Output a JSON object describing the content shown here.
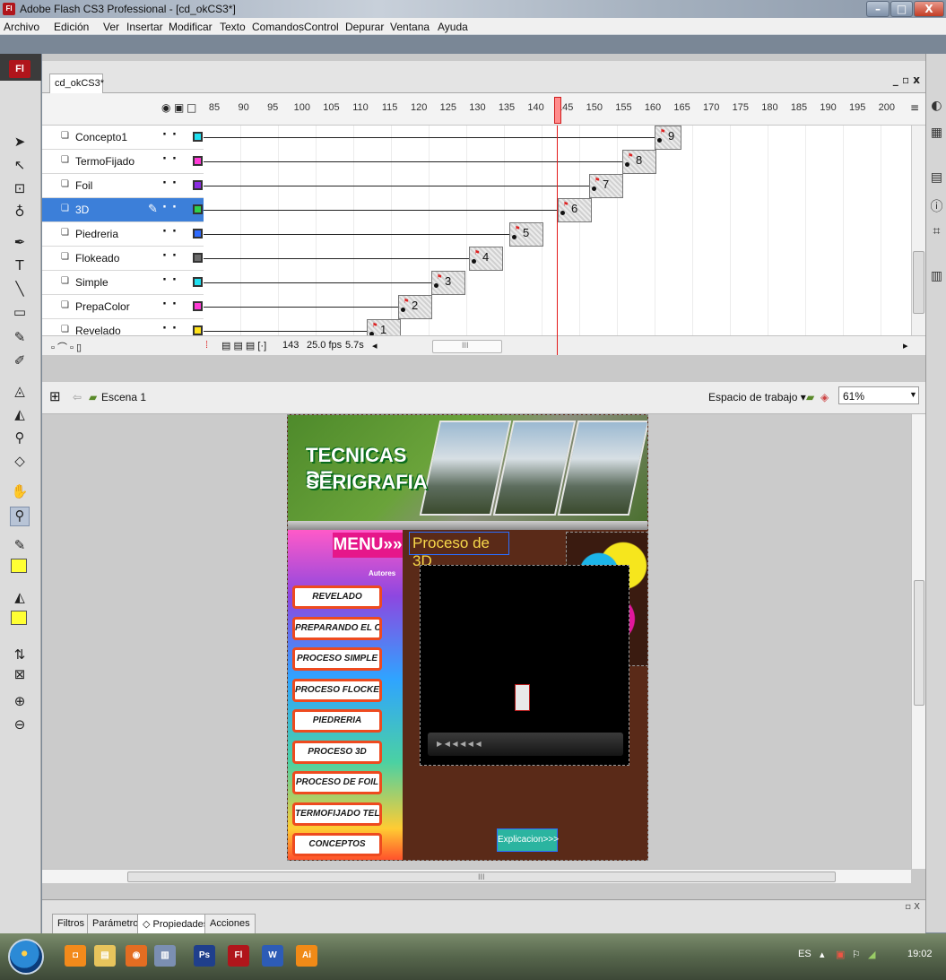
{
  "window": {
    "title": "Adobe Flash CS3 Professional - [cd_okCS3*]",
    "app_icon": "Fl",
    "minimize": "–",
    "maximize": "□",
    "close": "X"
  },
  "menubar": [
    "Archivo",
    "Edición",
    "Ver",
    "Insertar",
    "Modificar",
    "Texto",
    "Comandos",
    "Control",
    "Depurar",
    "Ventana",
    "Ayuda"
  ],
  "document": {
    "tab": "cd_okCS3*",
    "controls": "_ ▫ x"
  },
  "timeline": {
    "frame_numbers": [
      "85",
      "90",
      "95",
      "100",
      "105",
      "110",
      "115",
      "120",
      "125",
      "130",
      "135",
      "140",
      "145",
      "150",
      "155",
      "160",
      "165",
      "170",
      "175",
      "180",
      "185",
      "190",
      "195",
      "200"
    ],
    "layers": [
      {
        "name": "Concepto1",
        "color": "#20e0f0",
        "keyframe_label": "9"
      },
      {
        "name": "TermoFijado",
        "color": "#ff3ad6",
        "keyframe_label": "8"
      },
      {
        "name": "Foil",
        "color": "#8a2be2",
        "keyframe_label": "7"
      },
      {
        "name": "3D",
        "color": "#2ed04a",
        "keyframe_label": "6"
      },
      {
        "name": "Piedreria",
        "color": "#2f6bff",
        "keyframe_label": "5"
      },
      {
        "name": "Flokeado",
        "color": "#6b6b6b",
        "keyframe_label": "4"
      },
      {
        "name": "Simple",
        "color": "#20e0f0",
        "keyframe_label": "3"
      },
      {
        "name": "PrepaColor",
        "color": "#ff3ad6",
        "keyframe_label": "2"
      },
      {
        "name": "Revelado",
        "color": "#ffe21a",
        "keyframe_label": "1"
      }
    ],
    "active_layer": "3D",
    "current_frame": "143",
    "fps": "25.0 fps",
    "elapsed": "5.7s",
    "scroll_label": "III"
  },
  "editbar": {
    "scene": "Escena 1",
    "workspace": "Espacio de trabajo ▾",
    "zoom": "61%"
  },
  "stage": {
    "banner_title_line1": "TECNICAS DE",
    "banner_title_line2": "SERIGRAFIA",
    "menu_header": "MENU»»",
    "autores": "Autores",
    "menu_buttons": [
      "REVELADO",
      "PREPARANDO EL COLOR",
      "PROCESO SIMPLE",
      "PROCESO FLOCKEADO",
      "PIEDRERIA",
      "PROCESO 3D",
      "PROCESO DE FOIL",
      "TERMOFIJADO TELA POLAR",
      "CONCEPTOS"
    ],
    "section_title": "Proceso de 3D",
    "player_controls": "▶  ◀ ◀  ◀ ◀ ◀",
    "explic_button": "Explicacion>>>"
  },
  "stage_scroll": {
    "label": "III"
  },
  "properties_panel": {
    "tabs": [
      "Filtros",
      "Parámetros",
      "◇ Propiedades ×",
      "Acciones"
    ],
    "active_tab": "◇ Propiedades ×",
    "controls": "▫ X"
  },
  "taskbar": {
    "language": "ES",
    "clock": "19:02",
    "items": [
      {
        "icon": "orange-app-icon",
        "color": "#f28a1b",
        "glyph": "◘"
      },
      {
        "icon": "folder-icon",
        "color": "#e7c45c",
        "glyph": "▤"
      },
      {
        "icon": "firefox-icon",
        "color": "#e36d22",
        "glyph": "◉"
      },
      {
        "icon": "archive-icon",
        "color": "#7b8fb2",
        "glyph": "▥"
      },
      {
        "icon": "photoshop-icon",
        "color": "#1f3f8c",
        "glyph": "Ps"
      },
      {
        "icon": "flash-icon",
        "color": "#b0151b",
        "glyph": "Fl"
      },
      {
        "icon": "word-icon",
        "color": "#2d5cb6",
        "glyph": "W"
      },
      {
        "icon": "illustrator-icon",
        "color": "#f08a17",
        "glyph": "Ai"
      }
    ]
  }
}
